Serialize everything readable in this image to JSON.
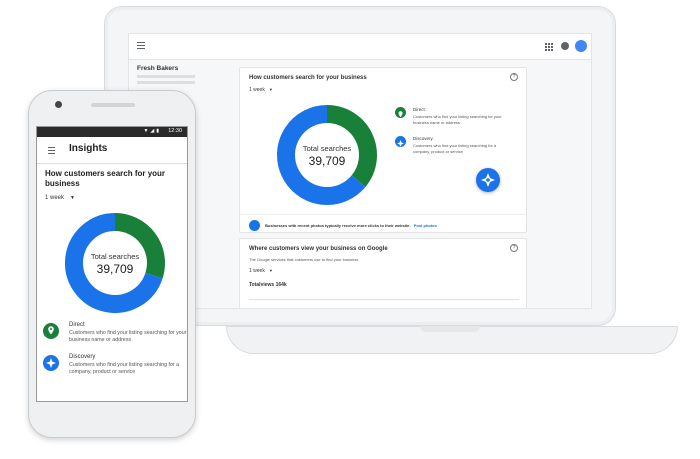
{
  "laptop": {
    "business_name": "Fresh Bakers",
    "search_card": {
      "title": "How customers search for your business",
      "period": "1 week",
      "total_label": "Total searches",
      "total_value": "39,709",
      "legend": [
        {
          "title": "Direct",
          "desc": "Customers who find your listing searching for your business name or address",
          "color": "#188038",
          "icon": "map-pin-icon"
        },
        {
          "title": "Discovery",
          "desc": "Customers who find your listing searching for a company, product or service",
          "color": "#1a73e8",
          "icon": "compass-icon"
        }
      ],
      "tip_text": "Businesses with recent photos typically receive more clicks to their website.",
      "tip_link": "Post photos"
    },
    "views_card": {
      "title": "Where customers view your business on Google",
      "subtitle": "The Google services that customers use to find your business",
      "period": "1 week",
      "total_views": "Totalviews 164k"
    }
  },
  "phone": {
    "status_time": "12:30",
    "status_icons": "▼◢▮",
    "title": "Insights",
    "heading": "How customers search for your business",
    "period": "1 week",
    "total_label": "Total searches",
    "total_value": "39,709",
    "legend": [
      {
        "title": "Direct",
        "desc": "Customers who find your listing searching for your business name or address",
        "color": "#188038",
        "icon": "map-pin-icon"
      },
      {
        "title": "Discovery",
        "desc": "Customers who find your listing searching for a company, product or service",
        "color": "#1a73e8",
        "icon": "compass-icon"
      }
    ]
  },
  "chart_data": [
    {
      "type": "pie",
      "categories": [
        "Direct",
        "Discovery"
      ],
      "values": [
        0.36,
        0.64
      ],
      "colors": [
        "#188038",
        "#1a73e8"
      ],
      "title": "Total searches",
      "total": "39,709"
    },
    {
      "type": "pie",
      "categories": [
        "Direct",
        "Discovery"
      ],
      "values": [
        0.3,
        0.7
      ],
      "colors": [
        "#188038",
        "#1a73e8"
      ],
      "title": "Total searches",
      "total": "39,709"
    }
  ]
}
